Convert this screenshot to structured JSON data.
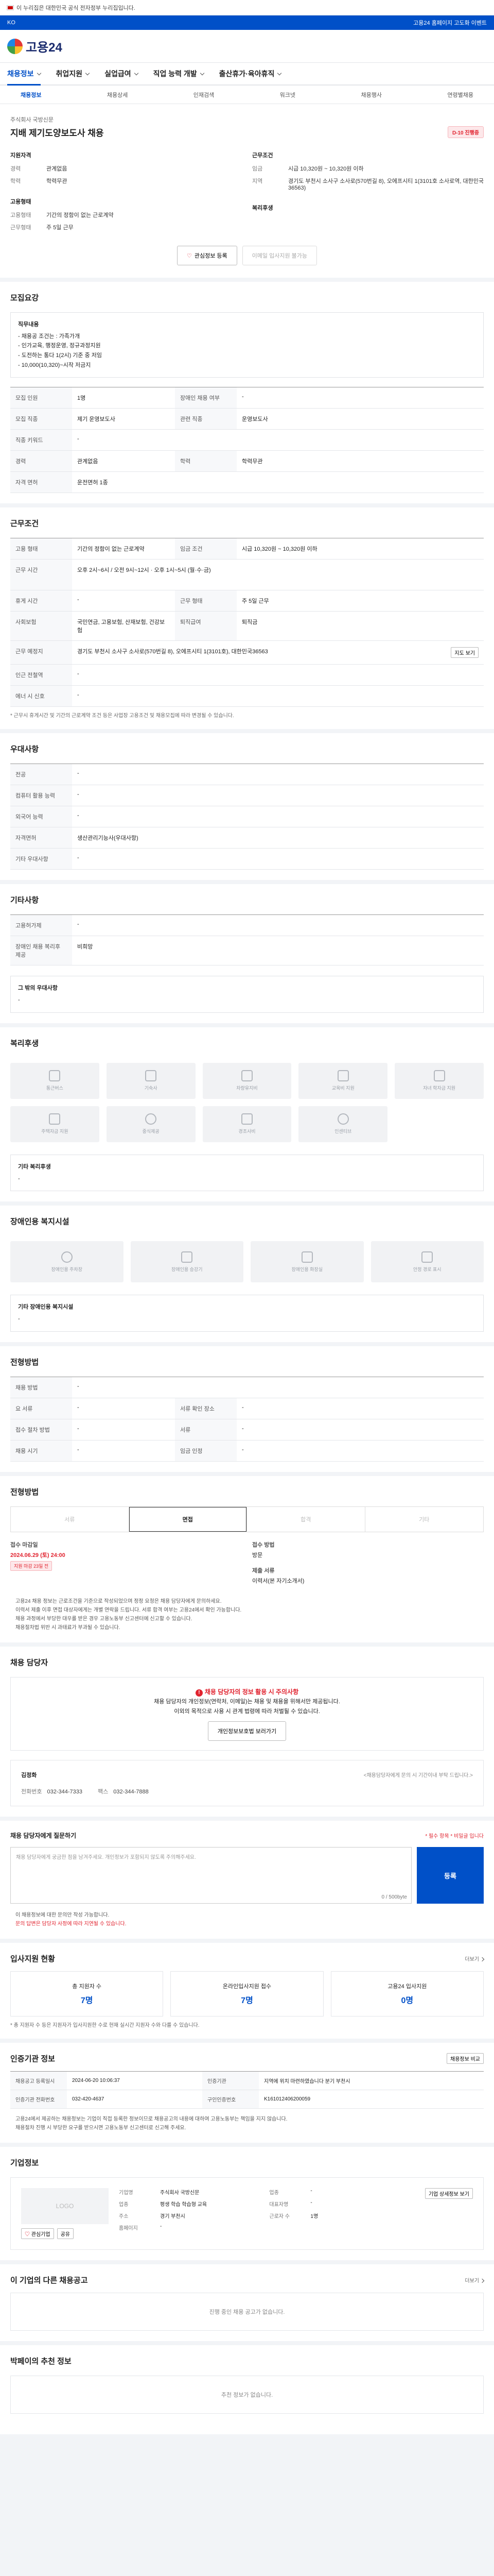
{
  "topbar": {
    "text": "이 누리집은 대한민국 공식 전자정부 누리집입니다."
  },
  "bluebar": {
    "left": "KO",
    "right": "고용24 홈페이지 고도화 이벤트"
  },
  "header": {
    "logo": "고용24"
  },
  "gnb": {
    "items": [
      "채용정보",
      "취업지원",
      "실업급여",
      "직업 능력 개발",
      "출산휴가·육아휴직"
    ]
  },
  "subnav": {
    "items": [
      "채용정보",
      "채용상세",
      "인재검색",
      "워크넷",
      "채용행사",
      "연령별채용"
    ]
  },
  "job": {
    "company": "주식회사 국방신문",
    "title": "지배 제기도양보도사 채용",
    "badge": "D-10 진행중",
    "apply": {
      "heading": "지원자격",
      "rows": [
        {
          "k": "경력",
          "v": "관계없음"
        },
        {
          "k": "학력",
          "v": "학력무관"
        }
      ]
    },
    "conditions": {
      "heading": "근무조건",
      "rows": [
        {
          "k": "임금",
          "v": "시급 10,320원 ~ 10,320원 이하"
        },
        {
          "k": "지역",
          "v": "경기도 부천시 소사구 소사로(570번길 8), 오에프시티 1(3101호 소사로역, 대한민국36563)"
        }
      ]
    },
    "employment": {
      "heading": "고용형태",
      "rows": [
        {
          "k": "고용형태",
          "v": "기간의 정함이 없는 근로계약"
        },
        {
          "k": "근무형태",
          "v": "주 5일 근무"
        }
      ]
    },
    "welfare": {
      "heading": "복리후생"
    },
    "btn_scrap": "관심정보 등록",
    "btn_apply": "이메일 입사지원 불가능"
  },
  "recruit": {
    "title": "모집요강",
    "box_title": "직무내용",
    "box_lines": [
      "- 채용공 조건는 : 가족가개",
      "- 인가교육, 행정운영, 정규과정지원",
      "- 도전하는 통다 1(2시) 기준 중 저임",
      "- 10,000(10,320)~시작 저금지"
    ],
    "rows": [
      {
        "k": "모집 인원",
        "v": "1명",
        "k2": "장애인 채용 여부",
        "v2": "-"
      },
      {
        "k": "모집 직종",
        "v": "제기 운영보도사",
        "k2": "관련 직종",
        "v2": "운영보도사"
      },
      {
        "k": "직종 키워드",
        "v": "-",
        "k2": "",
        "v2": ""
      },
      {
        "k": "경력",
        "v": "관계없음",
        "k2": "학력",
        "v2": "학력무관"
      },
      {
        "k": "자격 면허",
        "v": "운전면허 1종",
        "k2": "",
        "v2": ""
      }
    ]
  },
  "work": {
    "title": "근무조건",
    "rows": [
      {
        "k": "고용 형태",
        "v": "기간의 정함이 없는 근로계약",
        "k2": "임금 조건",
        "v2": "시급 10,320원 ~ 10,320원 이하"
      },
      {
        "k": "근무 시간",
        "v": "오후 2시~6시 / 오전 9시~12시 · 오후 1시~5시 (월·수·금)",
        "k2": "",
        "v2": ""
      },
      {
        "k": "휴게 시간",
        "v": "-",
        "k2": "근무 형태",
        "v2": "주 5일 근무"
      },
      {
        "k": "사회보험",
        "v": "국민연금, 고용보험, 산재보험, 건강보험",
        "k2": "퇴직급여",
        "v2": "퇴직금"
      },
      {
        "k": "근무 예정지",
        "v": "경기도 부천시 소사구 소사로(570번길 8), 오에프시티 1(3101호), 대한민국36563",
        "k2": "",
        "v2": ""
      },
      {
        "k": "인근 전철역",
        "v": "-",
        "k2": "",
        "v2": ""
      },
      {
        "k": "에너 시 신호",
        "v": "-",
        "k2": "",
        "v2": ""
      }
    ],
    "map_btn": "지도 보기",
    "note": "* 근무시 휴게시간 및 기간의 근로계약 조건 등은 사업장 고용조건 및 채용모집에 따라 변경될 수 있습니다."
  },
  "prefer": {
    "title": "우대사항",
    "rows": [
      {
        "k": "전공",
        "v": "-"
      },
      {
        "k": "컴퓨터 활용 능력",
        "v": "-"
      },
      {
        "k": "외국어 능력",
        "v": "-"
      },
      {
        "k": "자격면허",
        "v": "생산관리기능사(우대사항)"
      },
      {
        "k": "기타 우대사항",
        "v": "-"
      }
    ]
  },
  "other": {
    "title": "기타사항",
    "rows": [
      {
        "k": "고용허가제",
        "v": "-"
      },
      {
        "k": "장애인 채용 복리후 제공",
        "v": "비희망"
      }
    ],
    "sub_title": "그 밖의 우대사항",
    "sub_value": "-"
  },
  "welfare": {
    "title": "복리후생",
    "items": [
      "통근버스",
      "기숙사",
      "차량유지비",
      "교육비 지원",
      "자녀 학자금 지원",
      "주택자금 지원",
      "중식제공",
      "경조사비",
      "인센티브"
    ],
    "etc_title": "기타 복리후생",
    "etc_value": "-"
  },
  "disabled": {
    "title": "장애인용 복지시설",
    "items": [
      "장애인용 주차장",
      "장애인용 승강기",
      "장애인용 화장실",
      "안정 경로 표시"
    ],
    "etc_title": "기타 장애인용 복지시설",
    "etc_value": "-"
  },
  "method": {
    "title": "전형방법",
    "rows": [
      {
        "k": "채용 방법",
        "v": "-"
      },
      {
        "k": "요 서류",
        "v": "-",
        "k2": "서류 확인 장소",
        "v2": "-"
      },
      {
        "k": "접수 절차 방법",
        "v": "-",
        "k2": "서류",
        "v2": "-"
      },
      {
        "k": "채용 시기",
        "v": "-",
        "k2": "임금 인정",
        "v2": "-"
      }
    ]
  },
  "process": {
    "title": "전형방법",
    "steps": [
      "서류",
      "면접",
      "합격",
      "기타"
    ],
    "deadline_label": "접수 마감일",
    "deadline": "2024.06.29 (토) 24:00",
    "deadline_badge": "지원 마감 23일 전",
    "method_label": "접수 방법",
    "method_value": "방문",
    "docs_label": "제출 서류",
    "docs_value": "이력서(본 자기소개서)",
    "bullets": [
      "고용24 채용 정보는 근로조건을 기준으로 작성되었으며 정정 요청은 채용 담당자에게 문의하세요.",
      "이력서 제출 이후 면접 대상자에게는 개별 연락을 드립니다. 서류 합격 여부는 고용24에서 확인 가능합니다.",
      "채용 과정에서 부당한 대우를 받은 경우 고용노동부 신고센터에 신고할 수 있습니다.",
      "채용절차법 위반 시 과태료가 부과될 수 있습니다."
    ]
  },
  "contact": {
    "title": "채용 담당자",
    "warn_title": "채용 담당자의 정보 활용 시 주의사항",
    "warn_lines": [
      "채용 담당자의 개인정보(연락처, 이메일)는 채용 및 채용을 위해서만 제공됩니다.",
      "이외의 목적으로 사용 시 관계 법령에 따라 처벌될 수 있습니다."
    ],
    "warn_btn": "개인정보보호법 보러가기",
    "name_label": "김정화",
    "note_right": "<채용담당자에게 문의 시 기간이내 부탁 드립니다.>",
    "tel_label": "전화번호",
    "tel": "032-344-7333",
    "fax_label": "팩스",
    "fax": "032-344-7888"
  },
  "inquiry": {
    "title": "채용 담당자에게 질문하기",
    "required": "* 필수 항목 * 비밀글 입니다",
    "placeholder": "채용 담당자에게 궁금한 점을 남겨주세요. 개인정보가 포함되지 않도록 주의해주세요.",
    "count": "0 / 500byte",
    "send": "등록",
    "notes": [
      "이 채용정보에 대한 문의만 작성 가능합니다.",
      "문의 답변은 담당자 사정에 따라 지연될 수 있습니다."
    ]
  },
  "applicants": {
    "title": "입사지원 현황",
    "link": "더보기",
    "stats": [
      {
        "label": "총 지원자 수",
        "value": "7명"
      },
      {
        "label": "온라인입사지원 접수",
        "value": "7명"
      },
      {
        "label": "고용24 입사지원",
        "value": "0명"
      }
    ],
    "note": "* 총 지원자 수 등은 지원자가 입사지원한 수로 현재 실시간 지원자 수와 다를 수 있습니다."
  },
  "agency": {
    "title": "인증기관 정보",
    "link": "채용정보 비교",
    "rows": [
      {
        "k": "채용공고 등록일시",
        "v": "2024-06-20 10:06:37",
        "k2": "인증기관",
        "v2": "지역에 위치 마련하였습니다 분기 부천시"
      },
      {
        "k": "인증기관 전화번호",
        "v": "032-420-4637",
        "k2": "구인인증번호",
        "v2": "K161012406200059"
      }
    ],
    "notes": [
      "고용24에서 제공하는 채용정보는 기업이 직접 등록한 정보이므로 채용공고의 내용에 대하여 고용노동부는 책임을 지지 않습니다.",
      "채용절차 진행 시 부당한 요구를 받으시면 고용노동부 신고센터로 신고해 주세요."
    ]
  },
  "company": {
    "title": "기업정보",
    "logo": "LOGO",
    "btn_save": "관심기업",
    "btn_share": "공유",
    "rows": [
      {
        "k": "기업명",
        "v": "주식회사 국방신문",
        "k2": "업종",
        "v2": "-"
      },
      {
        "k": "업종",
        "v": "평생 학습 학습형 교육",
        "k2": "대표자명",
        "v2": "-"
      },
      {
        "k": "주소",
        "v": "경기 부천시",
        "k2": "근로자 수",
        "v2": "1명"
      },
      {
        "k": "홈페이지",
        "v": "-",
        "k2": "",
        "v2": ""
      }
    ],
    "detail_btn": "기업 상세정보 보기"
  },
  "same_company": {
    "title": "이 기업의 다른 채용공고",
    "link": "더보기",
    "empty": "진행 중인 채용 공고가 없습니다."
  },
  "recommend": {
    "title": "박페이의 추천 정보",
    "empty": "추천 정보가 없습니다."
  }
}
